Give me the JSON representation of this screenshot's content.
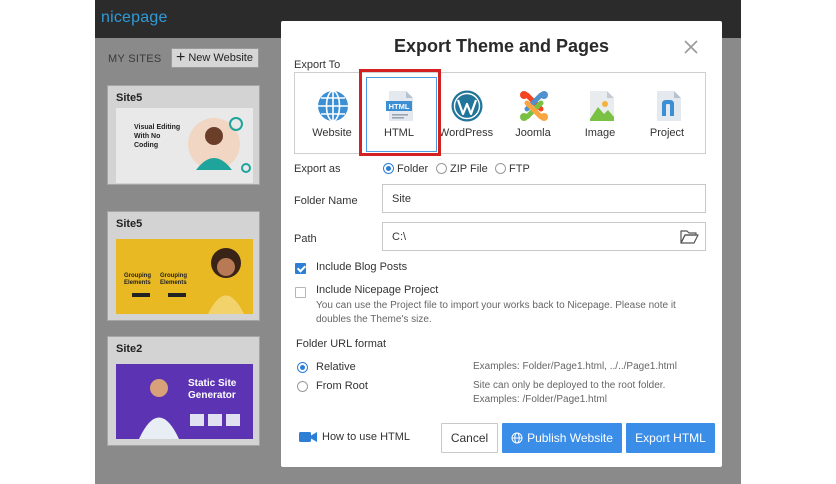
{
  "app": {
    "logo": "nicepage",
    "my_sites_label": "MY SITES",
    "new_website_label": "New Website",
    "sites": [
      {
        "title": "Site5",
        "thumb_text": "Visual Editing With No Coding"
      },
      {
        "title": "Site5",
        "thumb_text": "Grouping Elements"
      },
      {
        "title": "Site2",
        "thumb_text": "Static Site Generator"
      }
    ]
  },
  "dialog": {
    "title": "Export Theme and Pages",
    "export_to_label": "Export To",
    "targets": [
      {
        "label": "Website",
        "icon": "globe-icon"
      },
      {
        "label": "HTML",
        "icon": "html-file-icon",
        "selected": true
      },
      {
        "label": "WordPress",
        "icon": "wordpress-icon"
      },
      {
        "label": "Joomla",
        "icon": "joomla-icon"
      },
      {
        "label": "Image",
        "icon": "image-file-icon"
      },
      {
        "label": "Project",
        "icon": "nicepage-project-icon"
      }
    ],
    "html_icon_text": "HTML",
    "export_as_label": "Export as",
    "export_as_options": [
      {
        "label": "Folder",
        "checked": true
      },
      {
        "label": "ZIP File",
        "checked": false
      },
      {
        "label": "FTP",
        "checked": false
      }
    ],
    "folder_name_label": "Folder Name",
    "folder_name_value": "Site",
    "path_label": "Path",
    "path_value": "C:\\",
    "include_blog_posts": {
      "label": "Include Blog Posts",
      "checked": true
    },
    "include_project": {
      "label": "Include Nicepage Project",
      "checked": false,
      "note_line1": "You can use the Project file to import your works back to Nicepage. Please note it",
      "note_line2": "doubles the Theme's size."
    },
    "folder_url_format_label": "Folder URL format",
    "url_options": [
      {
        "label": "Relative",
        "checked": true,
        "example": "Examples: Folder/Page1.html, ../../Page1.html"
      },
      {
        "label": "From Root",
        "checked": false,
        "example": "Site can only be deployed to the root folder.",
        "example2": "Examples: /Folder/Page1.html"
      }
    ],
    "how_to_label": "How to use HTML",
    "cancel_label": "Cancel",
    "publish_label": "Publish Website",
    "export_label": "Export HTML",
    "colors": {
      "accent": "#3b8ee8",
      "highlight": "#d42222"
    }
  }
}
